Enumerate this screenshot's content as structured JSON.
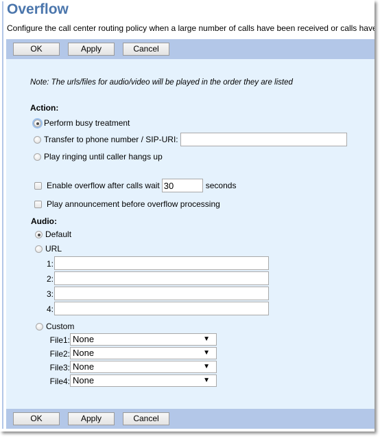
{
  "page": {
    "title": "Overflow",
    "description": "Configure the call center routing policy when a large number of calls have been received or calls have"
  },
  "toolbar": {
    "ok_label": "OK",
    "apply_label": "Apply",
    "cancel_label": "Cancel"
  },
  "note": "Note: The urls/files for audio/video will be played in the order they are listed",
  "action": {
    "heading": "Action:",
    "options": [
      {
        "label": "Perform busy treatment",
        "selected": true
      },
      {
        "label": "Transfer to phone number / SIP-URI:",
        "selected": false
      },
      {
        "label": "Play ringing until caller hangs up",
        "selected": false
      }
    ],
    "transfer_value": ""
  },
  "overflow": {
    "enable_label": "Enable overflow after calls wait",
    "enable_checked": false,
    "wait_value": "30",
    "seconds_label": "seconds",
    "announce_label": "Play announcement before overflow processing",
    "announce_checked": false
  },
  "audio": {
    "heading": "Audio:",
    "default_label": "Default",
    "default_selected": true,
    "url_label": "URL",
    "url_selected": false,
    "urls": [
      {
        "label": "1:",
        "value": ""
      },
      {
        "label": "2:",
        "value": ""
      },
      {
        "label": "3:",
        "value": ""
      },
      {
        "label": "4:",
        "value": ""
      }
    ],
    "custom_label": "Custom",
    "custom_selected": false,
    "files": [
      {
        "label": "File1:",
        "value": "None"
      },
      {
        "label": "File2:",
        "value": "None"
      },
      {
        "label": "File3:",
        "value": "None"
      },
      {
        "label": "File4:",
        "value": "None"
      }
    ]
  },
  "colors": {
    "title": "#4b76ac",
    "toolbar": "#b3c7e8",
    "panel": "#e5f2fd"
  }
}
